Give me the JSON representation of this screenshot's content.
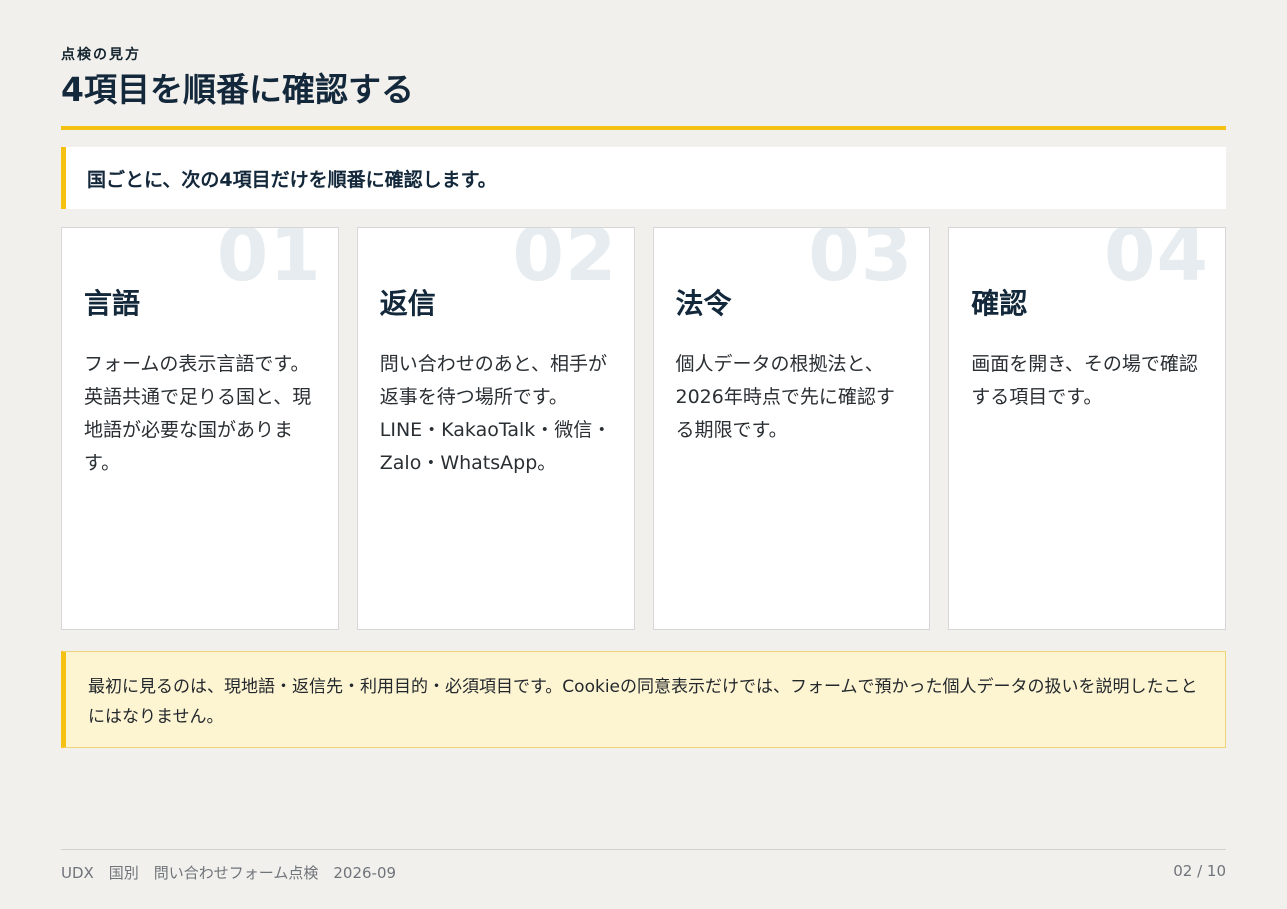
{
  "header": {
    "eyebrow": "点検の見方",
    "title": "4項目を順番に確認する"
  },
  "lead": "国ごとに、次の4項目だけを順番に確認します。",
  "cards": [
    {
      "number": "01",
      "title": "言語",
      "body": "フォームの表示言語です。英語共通で足りる国と、現地語が必要な国があります。"
    },
    {
      "number": "02",
      "title": "返信",
      "body": "問い合わせのあと、相手が返事を待つ場所です。LINE・KakaoTalk・微信・Zalo・WhatsApp。"
    },
    {
      "number": "03",
      "title": "法令",
      "body": "個人データの根拠法と、2026年時点で先に確認する期限です。"
    },
    {
      "number": "04",
      "title": "確認",
      "body": "画面を開き、その場で確認する項目です。"
    }
  ],
  "note": "最初に見るのは、現地語・返信先・利用目的・必須項目です。Cookieの同意表示だけでは、フォームで預かった個人データの扱いを説明したことにはなりません。",
  "footer": {
    "left": "UDX　国別　問い合わせフォーム点検　2026-09",
    "page": "02 / 10"
  },
  "colors": {
    "accent": "#f5c213",
    "background": "#f2f0ed",
    "heading": "#13283a",
    "note_bg": "#fdf4d2"
  }
}
